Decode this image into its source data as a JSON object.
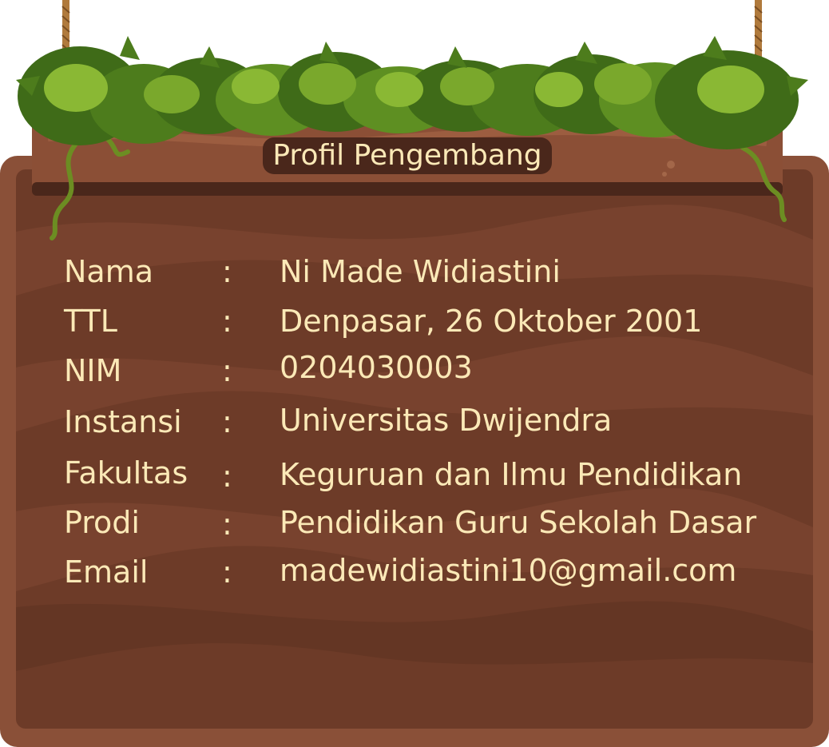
{
  "title": "Profil Pengembang",
  "fields": [
    {
      "label": "Nama",
      "separator": ":",
      "value": "Ni Made Widiastini"
    },
    {
      "label": "TTL",
      "separator": ":",
      "value": "Denpasar, 26 Oktober 2001"
    },
    {
      "label": "NIM",
      "separator": ":",
      "value": "0204030003"
    },
    {
      "label": "Instansi",
      "separator": ":",
      "value": "Universitas Dwijendra"
    },
    {
      "label": "Fakultas",
      "separator": ":",
      "value": "Keguruan dan Ilmu Pendidikan"
    },
    {
      "label": "Prodi",
      "separator": ":",
      "value": "Pendidikan Guru Sekolah Dasar"
    },
    {
      "label": "Email",
      "separator": ":",
      "value": "madewidiastini10@gmail.com"
    }
  ],
  "colors": {
    "board_outer": "#8a5038",
    "board_inner": "#6d3b28",
    "board_wave": "#7b4530",
    "plank": "#8b4f36",
    "plank_shadow": "#4a271b",
    "text": "#fbe9b7",
    "leaf_dark": "#3f6b18",
    "leaf_mid": "#5e8f22",
    "leaf_light": "#8ab834",
    "rope": "#b07a3c"
  }
}
